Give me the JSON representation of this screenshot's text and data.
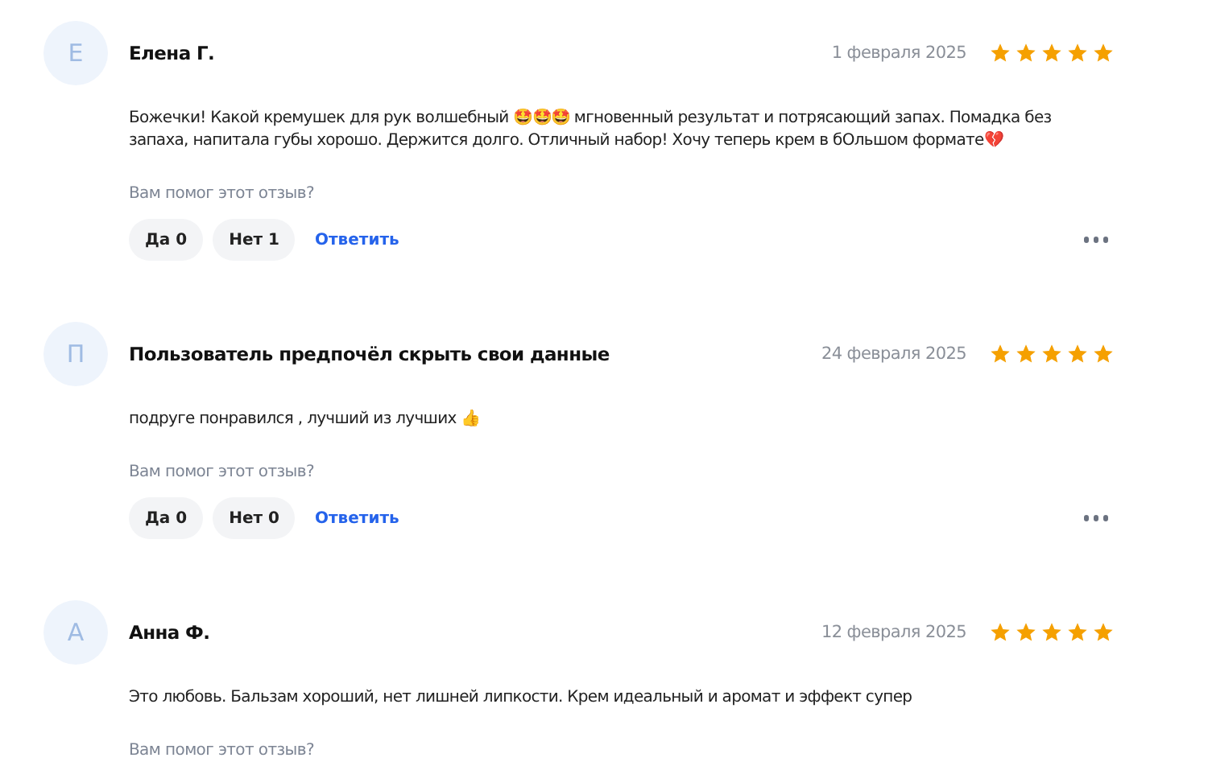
{
  "reviews": [
    {
      "avatar": "Е",
      "author": "Елена Г.",
      "date": "1 февраля 2025",
      "stars": 5,
      "text": "Божечки! Какой кремушек для рук волшебный 🤩🤩🤩 мгновенный результат и потрясающий запах. Помадка без запаха, напитала губы хорошо. Держится долго. Отличный набор! Хочу теперь крем в бОльшом формате💔",
      "helpful_prompt": "Вам помог этот отзыв?",
      "yes": "Да 0",
      "no": "Нет 1",
      "reply": "Ответить"
    },
    {
      "avatar": "П",
      "author": "Пользователь предпочёл скрыть свои данные",
      "date": "24 февраля 2025",
      "stars": 5,
      "text": "подруге понравился , лучший из лучших 👍",
      "helpful_prompt": "Вам помог этот отзыв?",
      "yes": "Да 0",
      "no": "Нет 0",
      "reply": "Ответить"
    },
    {
      "avatar": "А",
      "author": "Анна Ф.",
      "date": "12 февраля 2025",
      "stars": 5,
      "text": "Это любовь. Бальзам хороший, нет лишней липкости. Крем идеальный и аромат и эффект супер",
      "helpful_prompt": "Вам помог этот отзыв?"
    }
  ]
}
